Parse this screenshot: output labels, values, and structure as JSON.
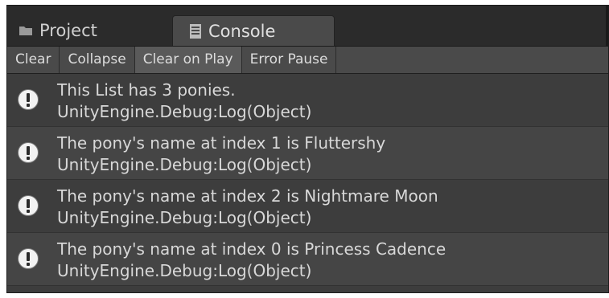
{
  "tabs": {
    "project": {
      "label": "Project",
      "icon": "folder-icon"
    },
    "console": {
      "label": "Console",
      "icon": "console-icon"
    }
  },
  "toolbar": {
    "clear": "Clear",
    "collapse": "Collapse",
    "clear_on_play": "Clear on Play",
    "error_pause": "Error Pause"
  },
  "entries": [
    {
      "message": "This List has 3 ponies.",
      "trace": "UnityEngine.Debug:Log(Object)",
      "icon": "info-icon"
    },
    {
      "message": "The pony's name at index 1 is Fluttershy",
      "trace": "UnityEngine.Debug:Log(Object)",
      "icon": "info-icon"
    },
    {
      "message": "The pony's name at index 2 is Nightmare Moon",
      "trace": "UnityEngine.Debug:Log(Object)",
      "icon": "info-icon"
    },
    {
      "message": "The pony's name at index 0 is Princess Cadence",
      "trace": "UnityEngine.Debug:Log(Object)",
      "icon": "info-icon"
    }
  ],
  "colors": {
    "background": "#3d3d3d",
    "tabbar": "#2b2b2b",
    "text": "#d8d8d8",
    "active_toggle": "#5a5a5a"
  }
}
